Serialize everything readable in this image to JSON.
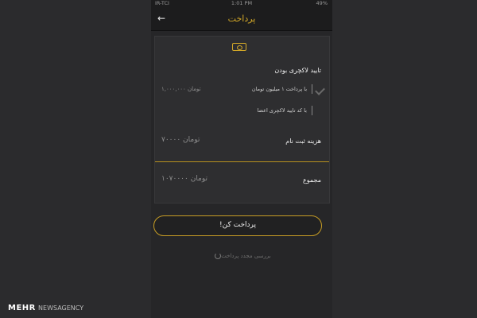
{
  "status_bar": {
    "carrier": "IR-TCI",
    "time": "1:01 PM",
    "battery": "49%"
  },
  "header": {
    "title": "پرداخت",
    "back_icon": "←"
  },
  "card": {
    "money_icon": "money-icon",
    "confirm_luxury_label": "تایید لاکچری بودن",
    "option_pay_million": "با پرداخت ۱ میلیون تومان",
    "option_pay_million_amount": "۱,۰۰۰,۰۰۰ تومان",
    "option_member_code": "با کد تایید لاکچری اعضا",
    "registration_fee_label": "هزینه ثبت نام",
    "registration_fee_amount": "۷۰۰۰۰ تومان",
    "total_label": "مجموع",
    "total_amount": "۱۰۷۰۰۰۰ تومان"
  },
  "pay_button_label": "پرداخت کن!",
  "recheck_label": "بررسی مجدد پرداخت",
  "watermark": {
    "brand": "MEHR",
    "agency": "NEWSAGENCY"
  },
  "colors": {
    "accent_gold": "#d4a928",
    "background": "#262628"
  }
}
